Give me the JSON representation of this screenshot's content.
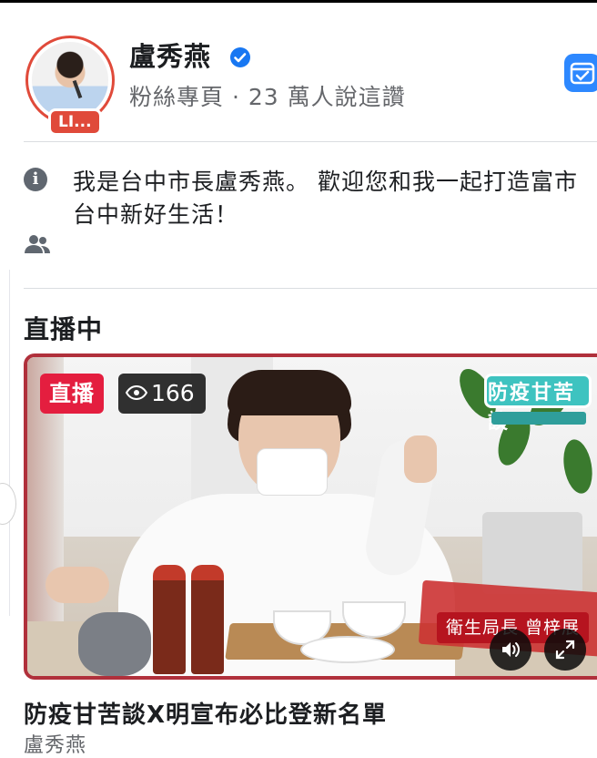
{
  "profile": {
    "name": "盧秀燕",
    "subtitle": "粉絲專頁 · 23 萬人說這讚",
    "live_pill": "LI..."
  },
  "about": {
    "bio": "我是台中市長盧秀燕。 歡迎您和我一起打造富市台中新好生活！"
  },
  "section": {
    "title": "直播中"
  },
  "video": {
    "live_label": "直播",
    "view_count": "166",
    "logo_text": "防疫甘苦談",
    "lower_third": "衛生局長 曾梓展",
    "title": "防疫甘苦談X明宣布必比登新名單",
    "author": "盧秀燕"
  },
  "colors": {
    "live_red": "#e41e3f",
    "accent_blue": "#2d88ff",
    "border_red": "#b0303b"
  }
}
